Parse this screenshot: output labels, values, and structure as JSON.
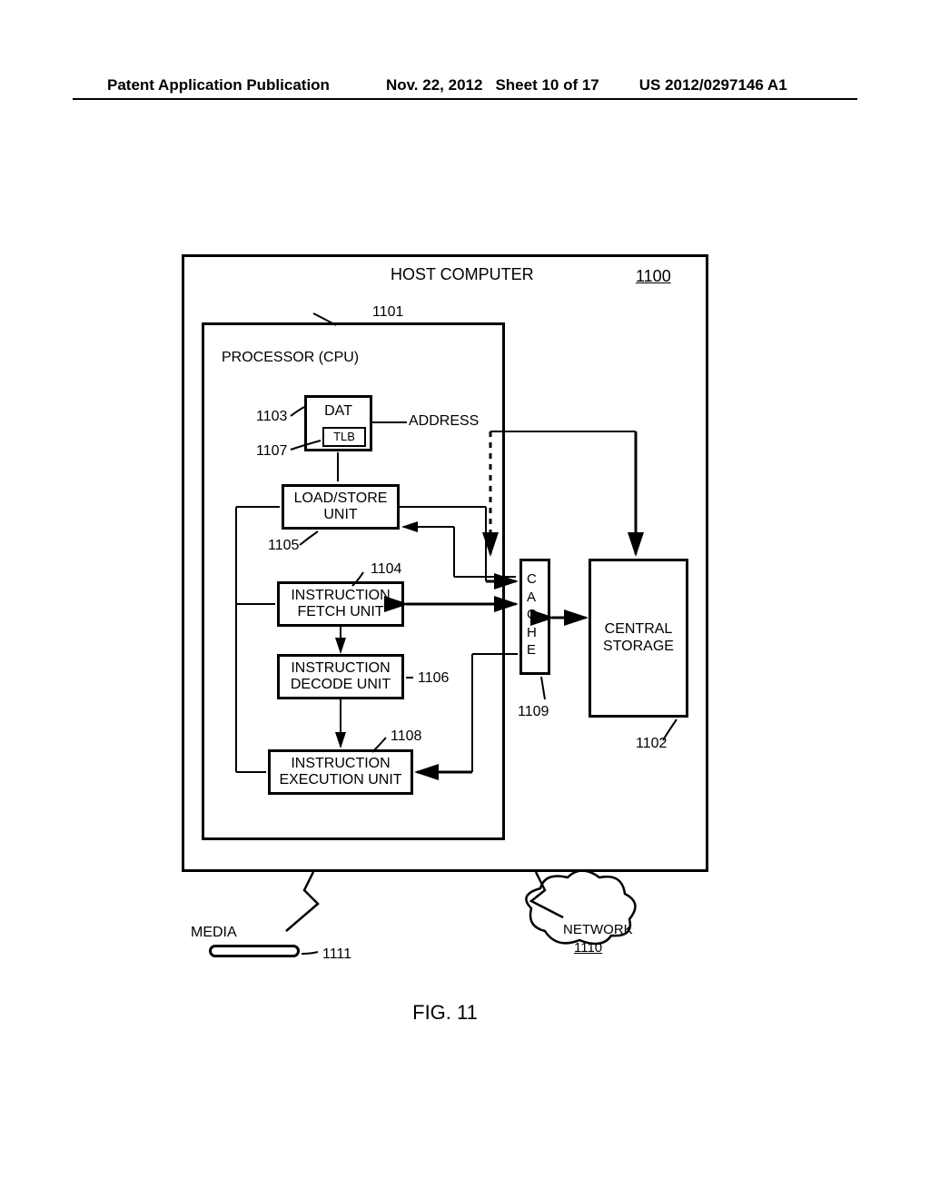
{
  "header": {
    "left": "Patent Application Publication",
    "date": "Nov. 22, 2012",
    "sheet": "Sheet 10 of 17",
    "pubno": "US 2012/0297146 A1"
  },
  "blocks": {
    "host": "HOST COMPUTER",
    "cpu": "PROCESSOR (CPU)",
    "dat": "DAT",
    "tlb": "TLB",
    "address": "ADDRESS",
    "lsu": "LOAD/STORE\nUNIT",
    "ifu": "INSTRUCTION\nFETCH UNIT",
    "idu": "INSTRUCTION\nDECODE UNIT",
    "ieu": "INSTRUCTION\nEXECUTION UNIT",
    "cache": "CACHE",
    "storage": "CENTRAL\nSTORAGE",
    "media": "MEDIA",
    "network": "NETWORK"
  },
  "refs": {
    "host": "1100",
    "cpu": "1101",
    "dat": "1103",
    "tlb": "1107",
    "lsu": "1105",
    "ifu": "1104",
    "idu": "1106",
    "ieu": "1108",
    "cache": "1109",
    "storage": "1102",
    "media": "1111",
    "network": "1110"
  },
  "figure": "FIG. 11"
}
